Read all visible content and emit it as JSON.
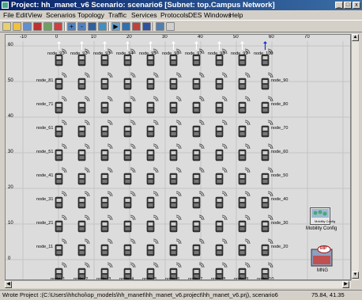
{
  "window": {
    "title": "Project: hh_manet_v6 Scenario: scenario6  [Subnet: top.Campus Network]",
    "minimize_glyph": "_",
    "maximize_glyph": "□",
    "close_glyph": "x"
  },
  "menu": [
    "File",
    "Edit",
    "View",
    "Scenarios",
    "Topology",
    "Traffic",
    "Services",
    "Protocols",
    "DES",
    "Windows",
    "Help"
  ],
  "toolbar": {
    "buttons": [
      "open-icon",
      "save-icon",
      "print-icon",
      "import-icon",
      "export-icon",
      "configure-icon",
      "zoom-in-icon",
      "zoom-out-icon",
      "fit-icon",
      "hand-icon",
      "run-icon",
      "results-icon",
      "fail-icon",
      "recover-icon",
      "report-icon",
      "help-icon"
    ]
  },
  "canvas": {
    "x_ruler": [
      "-10",
      "0",
      "10",
      "20",
      "30",
      "40",
      "50",
      "60",
      "70"
    ],
    "y_ruler": [
      "60",
      "50",
      "40",
      "30",
      "20",
      "10",
      "0"
    ],
    "top_labels": [
      "node_91",
      "node_92",
      "node_93",
      "node_94",
      "node_95",
      "node_96",
      "node_97",
      "node_98",
      "node_99",
      "node_100"
    ],
    "bottom_labels": [
      "node_1",
      "node_2",
      "node_3",
      "node_4",
      "node_5",
      "node_6",
      "node_7",
      "node_8",
      "node_9",
      "node_10"
    ],
    "left_labels": [
      "node_81",
      "node_71",
      "node_61",
      "node_51",
      "node_41",
      "node_31",
      "node_21",
      "node_11"
    ],
    "right_labels": [
      "node_90",
      "node_80",
      "node_70",
      "node_60",
      "node_50",
      "node_40",
      "node_30",
      "node_20"
    ],
    "mobility_box": {
      "title": "Mobility Config",
      "label": "Mobility Config"
    },
    "rip_box": {
      "badge": "RIP",
      "label": "MNG"
    }
  },
  "status": {
    "left_text": "Wrote Project :(C:\\Users\\hhchoi\\op_models\\hh_manet\\hh_manet_v6.project\\hh_manet_v6.prj), scenario6",
    "coords": "75.84, 41.35"
  }
}
